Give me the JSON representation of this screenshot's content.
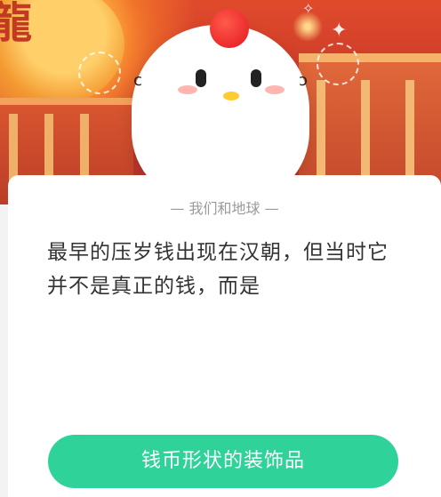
{
  "banner": {
    "lantern_text": "龍"
  },
  "quiz": {
    "category_label": "我们和地球",
    "question_text": "最早的压岁钱出现在汉朝，但当时它并不是真正的钱，而是",
    "answer_option": "钱币形状的装饰品"
  },
  "colors": {
    "banner_red": "#c7382a",
    "answer_green": "#2fd39a",
    "card_bg": "#ffffff"
  }
}
